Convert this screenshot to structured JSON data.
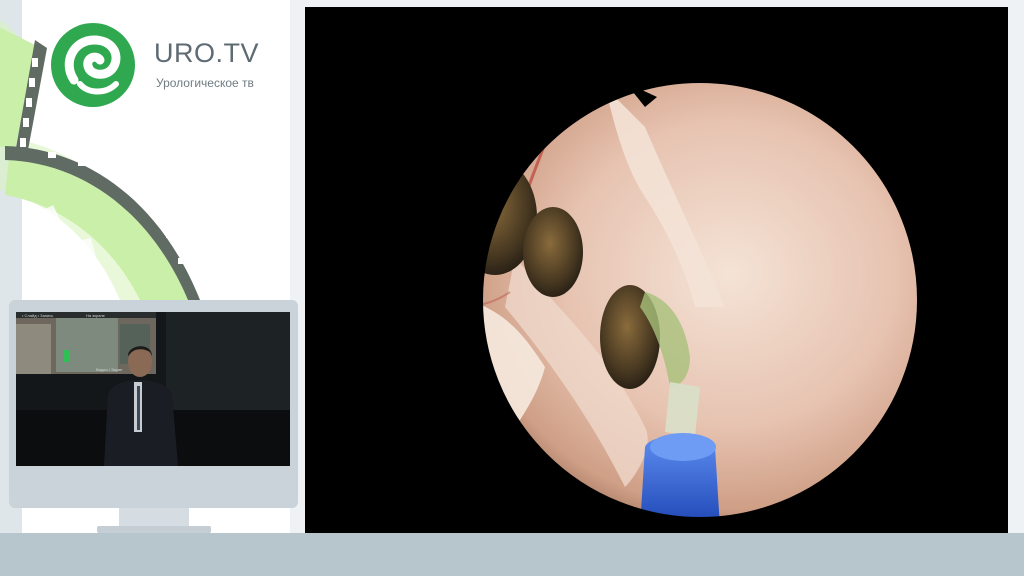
{
  "brand": {
    "name": "URO.TV",
    "tagline": "Урологическое тв",
    "logo_color": "#2fa84f"
  },
  "monitor": {
    "screen_label_left": "• Слайд • Запись",
    "screen_label_mid": "На экране",
    "screen_label_bottom": "Видео / Экран"
  },
  "icons": [
    "uro-tv-logo-icon",
    "film-strip-icon"
  ],
  "colors": {
    "accent_green": "#2fa84f",
    "film_green": "#c9efa8",
    "bottom_band": "#b7c5cd"
  }
}
